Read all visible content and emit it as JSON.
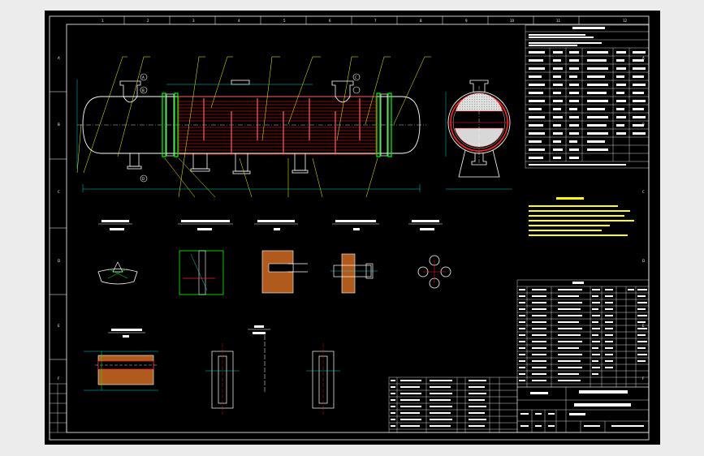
{
  "border": {
    "columns": [
      "1",
      "2",
      "3",
      "4",
      "5",
      "6",
      "7",
      "8",
      "9",
      "10",
      "11",
      "12"
    ],
    "rows": [
      "A",
      "B",
      "C",
      "D",
      "E",
      "F"
    ]
  },
  "views": {
    "section_labels": [
      "",
      "",
      "",
      "",
      ""
    ],
    "section_scales": [
      "",
      "",
      "",
      "",
      ""
    ],
    "nozzle_tags": [
      "A",
      "B",
      "C",
      "D"
    ]
  },
  "title_block": {
    "company": "",
    "drawing_title": "",
    "drawing_no": "",
    "scale": ""
  },
  "colors": {
    "background": "#000000",
    "frame": "#ffffff",
    "shell": "#ffffff",
    "tubes": "#ff2020",
    "baffles": "#ff4040",
    "tubesheet": "#00ff00",
    "leaders": "#ffff00",
    "dimensions": "#00ffff",
    "notes": "#ffff00",
    "section_fill": "#b05a1e",
    "shell_section": "#ff2020"
  }
}
